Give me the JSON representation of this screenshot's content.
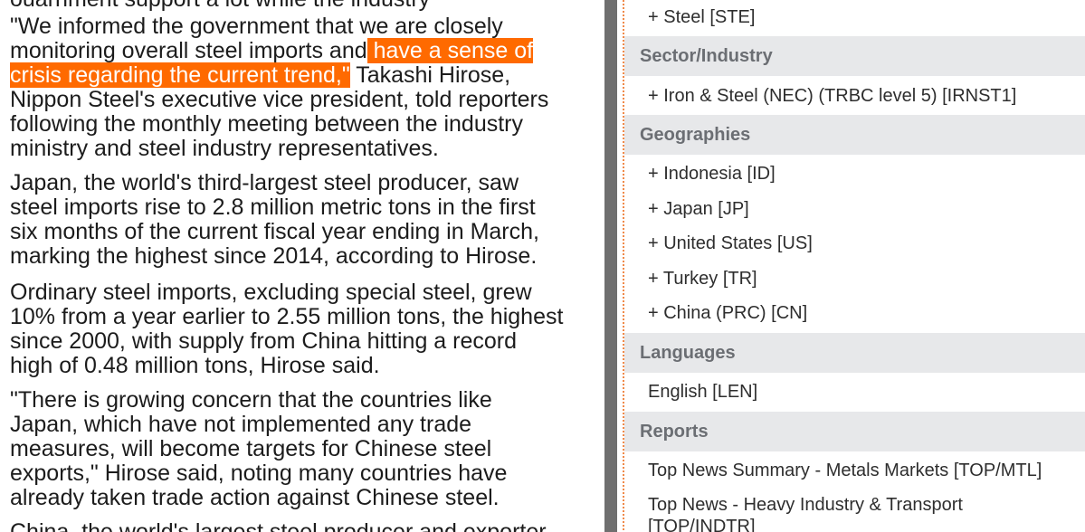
{
  "article": {
    "top_partial": "ouarnment support a lot while the industry",
    "para1": {
      "line1": "\"We informed the government that we are closely",
      "line2_pre": "monitoring overall steel imports and",
      "line2_hl": " have a sense of",
      "line3_hl": "crisis regarding the current trend,\"",
      "line3_post": " Takashi Hirose,",
      "line4": "Nippon Steel's executive vice president, told reporters",
      "line5": "following the monthly meeting between the industry",
      "line6": "ministry and steel industry representatives."
    },
    "para2": [
      "Japan, the world's third-largest steel producer, saw",
      "steel imports rise to 2.8 million metric tons in the first",
      "six months of the current fiscal year ending in March,",
      "marking the highest since 2014, according to Hirose."
    ],
    "para3": [
      "Ordinary steel imports, excluding special steel, grew",
      "10% from a year earlier to 2.55 million tons, the highest",
      "since 2000, with supply from China hitting a record",
      "high of 0.48 million tons, Hirose said."
    ],
    "para4": [
      "\"There is growing concern that the countries like",
      "Japan, which have not implemented any trade",
      "measures, will become targets for Chinese steel",
      "exports,\" Hirose said, noting many countries have",
      "already taken trade action against Chinese steel."
    ],
    "para5_partial": "China, the world's largest steel producer and exporter"
  },
  "panel": {
    "topics_item": "+ Steel [STE]",
    "sector_header": "Sector/Industry",
    "sector_item": "+ Iron & Steel (NEC) (TRBC level 5) [IRNST1]",
    "geo_header": "Geographies",
    "geo_items": [
      "+ Indonesia [ID]",
      "+ Japan [JP]",
      "+ United States [US]",
      "+ Turkey [TR]",
      "+ China (PRC) [CN]"
    ],
    "lang_header": "Languages",
    "lang_item": "English [LEN]",
    "reports_header": "Reports",
    "report_items": [
      "Top News Summary - Metals Markets [TOP/MTL]",
      "Top News - Heavy Industry & Transport [TOP/INDTR]"
    ]
  },
  "colors": {
    "highlight": "#ff6a00",
    "section_header_bg": "#e7e8ea",
    "scrollbar": "#6f6f6f"
  }
}
